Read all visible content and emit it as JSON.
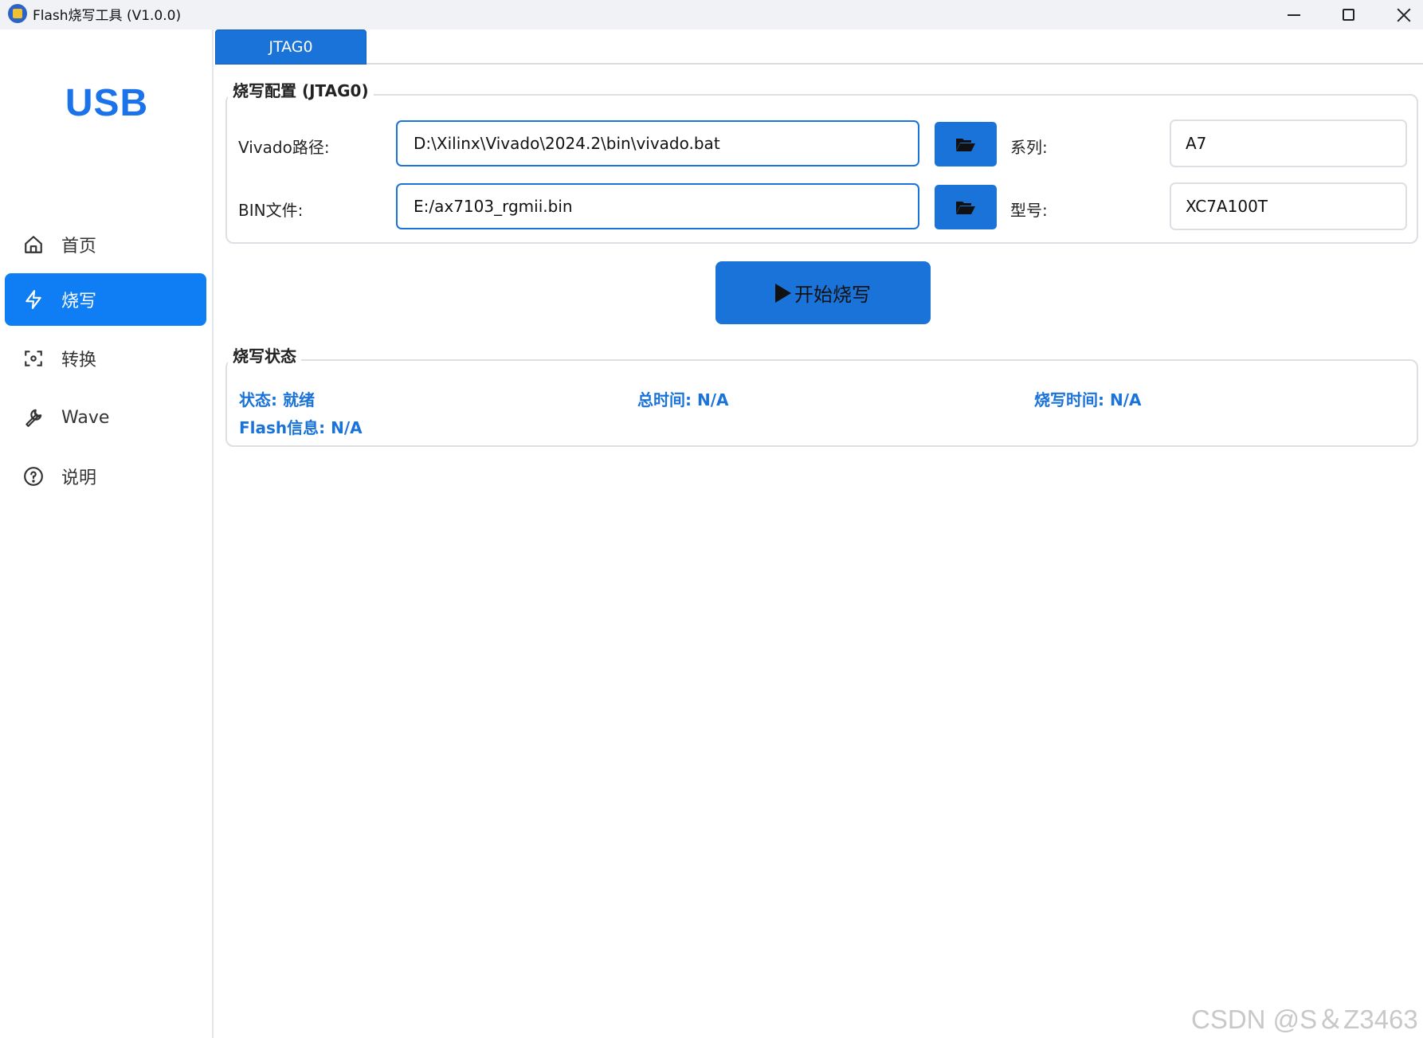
{
  "window": {
    "title": "Flash烧写工具 (V1.0.0)"
  },
  "sidebar": {
    "brand": "USB",
    "items": [
      {
        "label": "首页",
        "icon": "home-icon"
      },
      {
        "label": "烧写",
        "icon": "lightning-icon",
        "active": true
      },
      {
        "label": "转换",
        "icon": "scan-icon"
      },
      {
        "label": "Wave",
        "icon": "wrench-icon"
      },
      {
        "label": "说明",
        "icon": "help-circle-icon"
      }
    ]
  },
  "tabs": [
    {
      "label": "JTAG0",
      "active": true
    }
  ],
  "config": {
    "title": "烧写配置 (JTAG0)",
    "vivado_label": "Vivado路径:",
    "vivado_path": "D:\\Xilinx\\Vivado\\2024.2\\bin\\vivado.bat",
    "bin_label": "BIN文件:",
    "bin_path": "E:/ax7103_rgmii.bin",
    "series_label": "系列:",
    "series_value": "A7",
    "model_label": "型号:",
    "model_value": "XC7A100T"
  },
  "start_button": {
    "label": "开始烧写",
    "icon": "play-icon"
  },
  "status": {
    "title": "烧写状态",
    "state": "状态: 就绪",
    "total_time": "总时间: N/A",
    "burn_time": "烧写时间: N/A",
    "flash_info": "Flash信息: N/A"
  },
  "watermark": "CSDN @S＆Z3463",
  "colors": {
    "accent": "#1a73d9",
    "nav_active": "#0f7ef5",
    "brand": "#1a73e8"
  }
}
